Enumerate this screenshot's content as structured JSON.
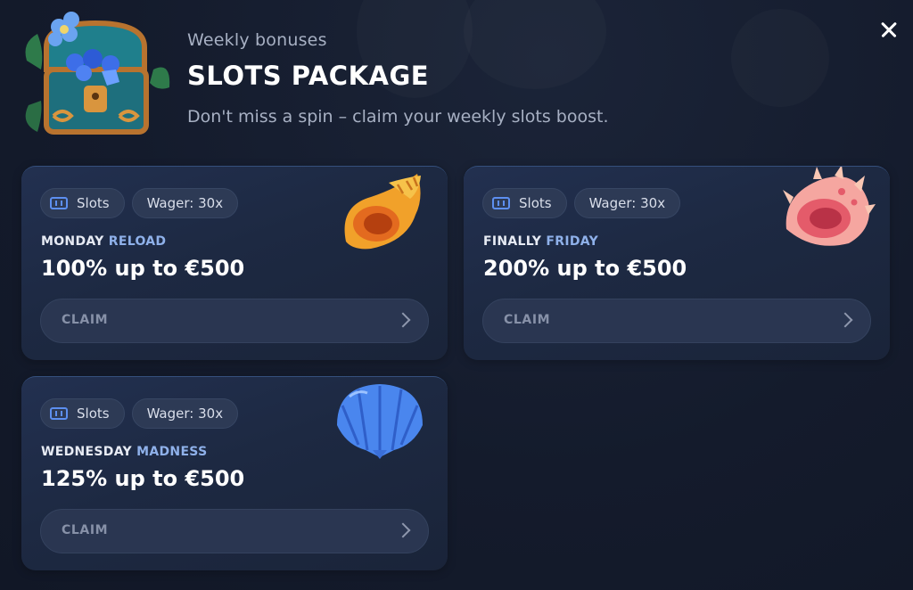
{
  "header": {
    "subtitle": "Weekly bonuses",
    "title": "SLOTS PACKAGE",
    "description": "Don't miss a spin – claim your weekly slots boost."
  },
  "colors": {
    "background": "#141b2c",
    "card": "#1d2942",
    "pill": "#2d3a55",
    "accent_blue": "#8fb1ea",
    "claim_text": "#8791a8"
  },
  "cards": [
    {
      "tags": {
        "category": "Slots",
        "wager": "Wager: 30x"
      },
      "name_part1": "MONDAY",
      "name_part2": "RELOAD",
      "offer": "100% up to €500",
      "claim_label": "CLAIM",
      "icon": "conch-shell-icon"
    },
    {
      "tags": {
        "category": "Slots",
        "wager": "Wager: 30x"
      },
      "name_part1": "FINALLY",
      "name_part2": "FRIDAY",
      "offer": "200% up to €500",
      "claim_label": "CLAIM",
      "icon": "spiky-shell-icon"
    },
    {
      "tags": {
        "category": "Slots",
        "wager": "Wager: 30x"
      },
      "name_part1": "WEDNESDAY",
      "name_part2": "MADNESS",
      "offer": "125% up to €500",
      "claim_label": "CLAIM",
      "icon": "scallop-shell-icon"
    }
  ],
  "icons": {
    "header": "treasure-chest-icon",
    "close": "close-icon",
    "tag": "slot-machine-icon",
    "claim": "chevron-right-icon"
  }
}
